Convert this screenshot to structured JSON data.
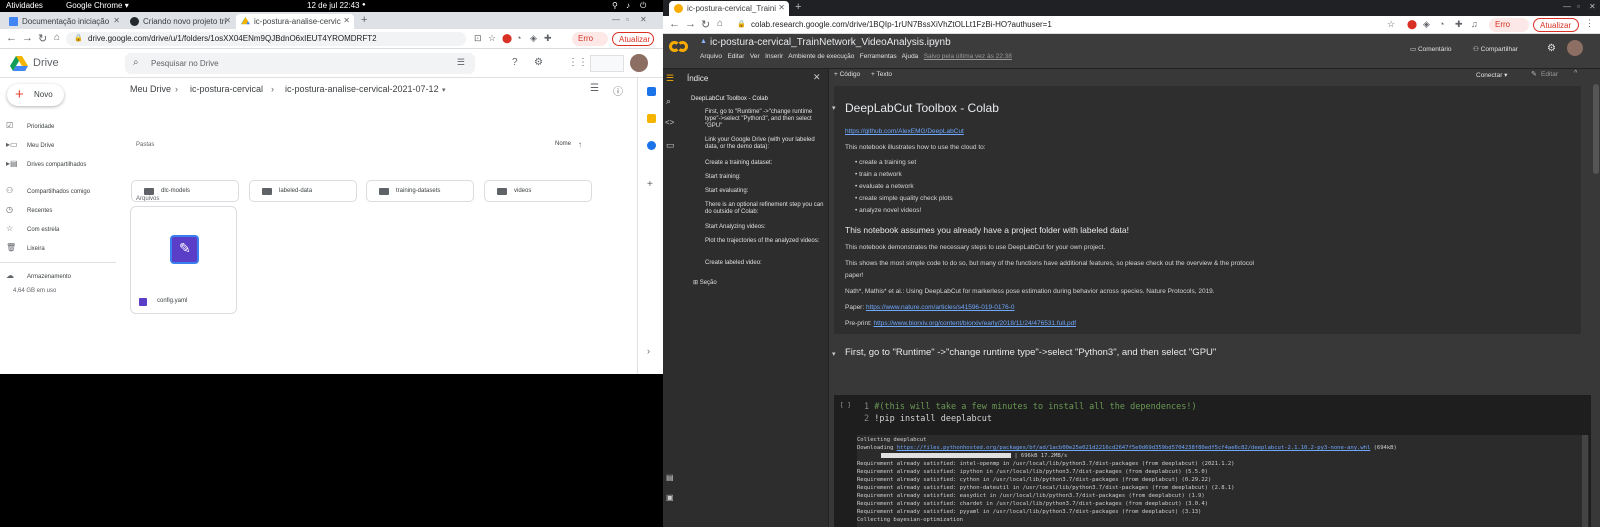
{
  "gnome": {
    "activities": "Atividades",
    "app": "Google Chrome ▾",
    "clock": "12 de jul  22:43"
  },
  "left_tabs": [
    {
      "title": "Documentação iniciação"
    },
    {
      "title": "Criando novo projeto tri"
    },
    {
      "title": "ic-postura-analise-cervic"
    }
  ],
  "left_url": "drive.google.com/drive/u/1/folders/1osXX04ENm9QJBdnO6xIEUT4YROMDRFT2",
  "left_error": "Erro",
  "left_update": "Atualizar",
  "drive": {
    "brand": "Drive",
    "search_placeholder": "Pesquisar no Drive",
    "new_label": "Novo",
    "nav": [
      "Prioridade",
      "Meu Drive",
      "Drives compartilhados",
      "Compartilhados comigo",
      "Recentes",
      "Com estrela",
      "Lixeira",
      "Armazenamento"
    ],
    "storage": "4,64 GB em uso",
    "breadcrumb": [
      "Meu Drive",
      "ic-postura-cervical",
      "ic-postura-analise-cervical-2021-07-12"
    ],
    "folders_label": "Pastas",
    "files_label": "Arquivos",
    "sort": "Nome",
    "folders": [
      "dlc-models",
      "labeled-data",
      "training-datasets",
      "videos"
    ],
    "file": "config.yaml",
    "accent": "#1a73e8"
  },
  "right_tab": "ic-postura-cervical_Traini",
  "right_url": "colab.research.google.com/drive/1BQIp-1rUN7BssXiVhZtOLLt1FzBi-HO?authuser=1",
  "right_error": "Erro",
  "right_update": "Atualizar",
  "colab": {
    "title": "ic-postura-cervical_TrainNetwork_VideoAnalysis.ipynb",
    "menu": [
      "Arquivo",
      "Editar",
      "Ver",
      "Inserir",
      "Ambiente de execução",
      "Ferramentas",
      "Ajuda"
    ],
    "saved": "Salvo pela última vez às 22:38",
    "comment": "Comentário",
    "share": "Compartilhar",
    "toc_title": "Índice",
    "toc": [
      "DeepLabCut Toolbox - Colab",
      "First, go to \"Runtime\" ->\"change runtime type\"->select \"Python3\", and then select \"GPU\"",
      "Link your Google Drive (with your labeled data, or the demo data):",
      "Create a training dataset:",
      "Start training:",
      "Start evaluating:",
      "There is an optional refinement step you can do outside of Colab:",
      "Start Analyzing videos:",
      "Plot the trajectories of the analyzed videos:",
      "Create labeled video:"
    ],
    "toc_section": "Seção",
    "add_code": "+ Código",
    "add_text": "+ Texto",
    "connect": "Conectar ▾",
    "edit": "Editar",
    "h1": "DeepLabCut Toolbox - Colab",
    "gh_link": "https://github.com/AlexEMG/DeepLabCut",
    "intro": "This notebook illustrates how to use the cloud to:",
    "bullets": [
      "create a training set",
      "train a network",
      "evaluate a network",
      "create simple quality check plots",
      "analyze novel videos!"
    ],
    "h2": "This notebook assumes you already have a project folder with labeled data!",
    "p1": "This notebook demonstrates the necessary steps to use DeepLabCut for your own project.",
    "p2a": "This shows the most simple code to do so, but many of the functions have additional features, so please check out the overview & the protocol",
    "p2b": "paper!",
    "cite": "Nath*, Mathis* et al.: Using DeepLabCut for markerless pose estimation during behavior across species. Nature Protocols, 2019.",
    "paper_label": "Paper:",
    "paper_link": "https://www.nature.com/articles/s41596-019-0176-0",
    "preprint_label": "Pre-print:",
    "preprint_link": "https://www.biorxiv.org/content/biorxiv/early/2018/11/24/476531.full.pdf",
    "h3": "First, go to \"Runtime\" ->\"change runtime type\"->select \"Python3\", and then select \"GPU\"",
    "cell_idx": "[ ]",
    "code": [
      "#(this will take a few minutes to install all the dependences!)",
      "!pip install deeplabcut"
    ],
    "output": [
      "Collecting deeplabcut",
      "  Downloading ",
      "Requirement already satisfied: intel-openmp in /usr/local/lib/python3.7/dist-packages (from deeplabcut) (2021.1.2)",
      "Requirement already satisfied: ipython in /usr/local/lib/python3.7/dist-packages (from deeplabcut) (5.5.0)",
      "Requirement already satisfied: cython in /usr/local/lib/python3.7/dist-packages (from deeplabcut) (0.29.22)",
      "Requirement already satisfied: python-dateutil in /usr/local/lib/python3.7/dist-packages (from deeplabcut) (2.8.1)",
      "Requirement already satisfied: easydict in /usr/local/lib/python3.7/dist-packages (from deeplabcut) (1.9)",
      "Requirement already satisfied: chardet in /usr/local/lib/python3.7/dist-packages (from deeplabcut) (3.0.4)",
      "Requirement already satisfied: pyyaml in /usr/local/lib/python3.7/dist-packages (from deeplabcut) (3.13)",
      "Collecting bayesian-optimization"
    ],
    "download_link": "https://files.pythonhosted.org/packages/bf/ad/1acb00e25e021d2216cd2647f5e0d69d359bd5704238f80edf5cf4ae6c82/deeplabcut-2.1.10.2-py3-none-any.whl",
    "download_size": "(694kB)",
    "progress_text": "| 696kB 17.2MB/s",
    "progress_fraction": 1.0
  }
}
